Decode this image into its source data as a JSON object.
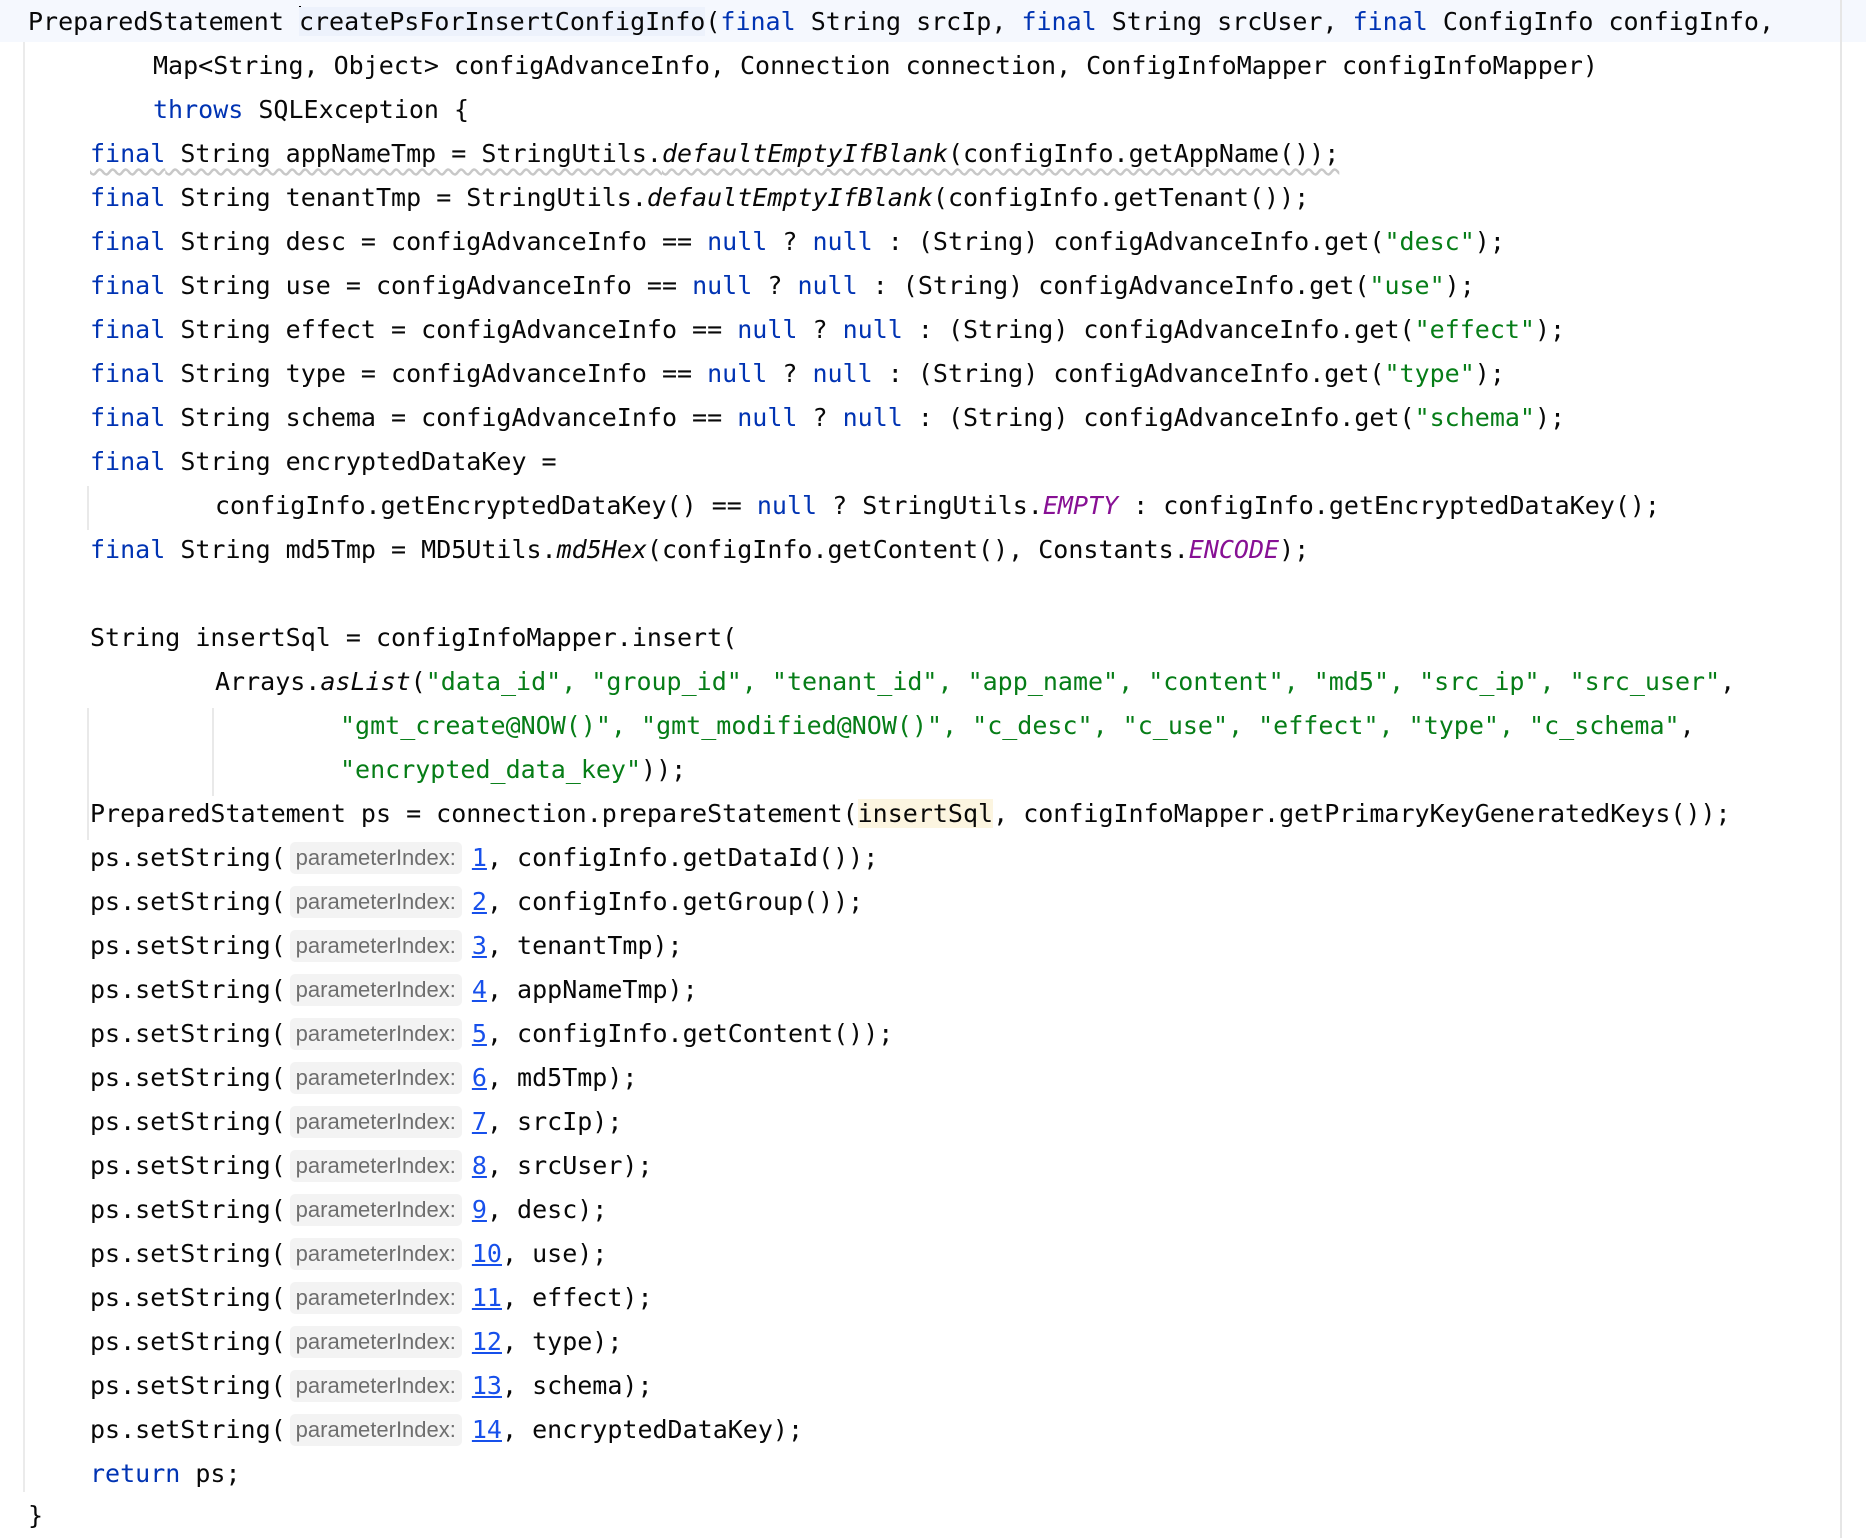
{
  "editor": {
    "hint_label": "parameterIndex:",
    "sig": {
      "return_type": "PreparedStatement",
      "method_name": "createPsForInsertConfigInfo",
      "kw_final": "final",
      "params_a1": "(",
      "params_a2": " String srcIp, ",
      "params_a3": " String srcUser, ",
      "params_a4": " ConfigInfo configInfo,",
      "params_b": "Map<String, Object> configAdvanceInfo, Connection connection, ConfigInfoMapper configInfoMapper)",
      "throws_kw": "throws",
      "throws_rest": " SQLException {"
    },
    "appname": {
      "rest1": " String appNameTmp = StringUtils.",
      "fn": "defaultEmptyIfBlank",
      "rest2": "(configInfo.getAppName());"
    },
    "tenant": {
      "rest1": " String tenantTmp = StringUtils.",
      "fn": "defaultEmptyIfBlank",
      "rest2": "(configInfo.getTenant());"
    },
    "adv_lines": [
      {
        "pre": " String desc = configAdvanceInfo == ",
        "mid": " ? ",
        "cast": " : (String) configAdvanceInfo.get(",
        "key": "\"desc\"",
        "end": ");"
      },
      {
        "pre": " String use = configAdvanceInfo == ",
        "mid": " ? ",
        "cast": " : (String) configAdvanceInfo.get(",
        "key": "\"use\"",
        "end": ");"
      },
      {
        "pre": " String effect = configAdvanceInfo == ",
        "mid": " ? ",
        "cast": " : (String) configAdvanceInfo.get(",
        "key": "\"effect\"",
        "end": ");"
      },
      {
        "pre": " String type = configAdvanceInfo == ",
        "mid": " ? ",
        "cast": " : (String) configAdvanceInfo.get(",
        "key": "\"type\"",
        "end": ");"
      },
      {
        "pre": " String schema = configAdvanceInfo == ",
        "mid": " ? ",
        "cast": " : (String) configAdvanceInfo.get(",
        "key": "\"schema\"",
        "end": ");"
      }
    ],
    "kw_null": "null",
    "enc": {
      "decl": " String encryptedDataKey =",
      "pre": "configInfo.getEncryptedDataKey() == ",
      "mid": " ? StringUtils.",
      "const": "EMPTY",
      "end": " : configInfo.getEncryptedDataKey();"
    },
    "md5": {
      "pre": " String md5Tmp = MD5Utils.",
      "fn": "md5Hex",
      "mid": "(configInfo.getContent(), Constants.",
      "const": "ENCODE",
      "end": ");"
    },
    "insert": {
      "l1": "String insertSql = configInfoMapper.insert(",
      "l2_pre": "Arrays.",
      "l2_fn": "asList",
      "l2_open": "(",
      "l2_strs": "\"data_id\", \"group_id\", \"tenant_id\", \"app_name\", \"content\", \"md5\", \"src_ip\", \"src_user\"",
      "l2_end": ",",
      "l3_strs": "\"gmt_create@NOW()\", \"gmt_modified@NOW()\", \"c_desc\", \"c_use\", \"effect\", \"type\", \"c_schema\"",
      "l3_end": ",",
      "l4_str": "\"encrypted_data_key\"",
      "l4_end": "));"
    },
    "prepare": {
      "pre": "PreparedStatement ps = connection.prepareStatement(",
      "var": "insertSql",
      "end": ", configInfoMapper.getPrimaryKeyGeneratedKeys());"
    },
    "setstring_prefix": "ps.setString(",
    "set_lines": [
      {
        "index": "1",
        "arg": ", configInfo.getDataId());"
      },
      {
        "index": "2",
        "arg": ", configInfo.getGroup());"
      },
      {
        "index": "3",
        "arg": ", tenantTmp);"
      },
      {
        "index": "4",
        "arg": ", appNameTmp);"
      },
      {
        "index": "5",
        "arg": ", configInfo.getContent());"
      },
      {
        "index": "6",
        "arg": ", md5Tmp);"
      },
      {
        "index": "7",
        "arg": ", srcIp);"
      },
      {
        "index": "8",
        "arg": ", srcUser);"
      },
      {
        "index": "9",
        "arg": ", desc);"
      },
      {
        "index": "10",
        "arg": ", use);"
      },
      {
        "index": "11",
        "arg": ", effect);"
      },
      {
        "index": "12",
        "arg": ", type);"
      },
      {
        "index": "13",
        "arg": ", schema);"
      },
      {
        "index": "14",
        "arg": ", encryptedDataKey);"
      }
    ],
    "ret_kw": "return",
    "ret_rest": " ps;",
    "close_brace": "}"
  }
}
